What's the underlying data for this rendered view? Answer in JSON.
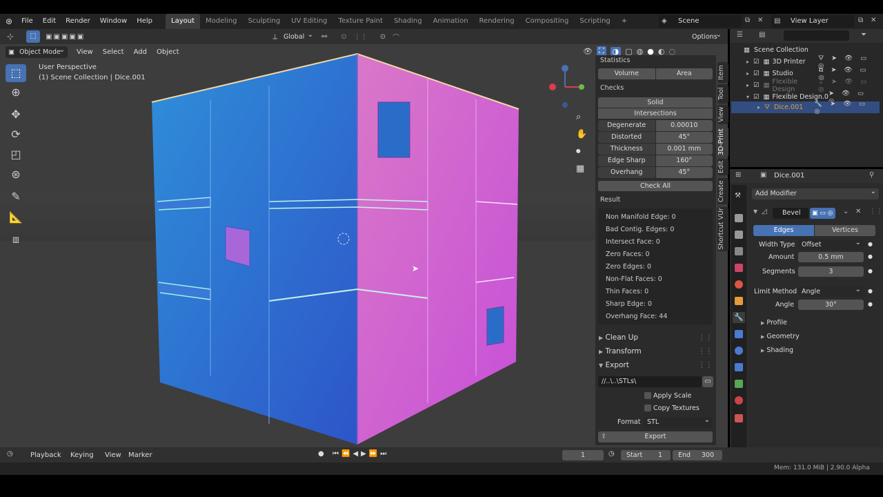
{
  "menu": [
    "File",
    "Edit",
    "Render",
    "Window",
    "Help"
  ],
  "workspaces": [
    "Layout",
    "Modeling",
    "Sculpting",
    "UV Editing",
    "Texture Paint",
    "Shading",
    "Animation",
    "Rendering",
    "Compositing",
    "Scripting"
  ],
  "active_workspace": "Layout",
  "scene": "Scene",
  "view_layer": "View Layer",
  "toolbar": {
    "orientation": "Global",
    "options": "Options"
  },
  "viewport_header": {
    "mode": "Object Mode",
    "menus": [
      "View",
      "Select",
      "Add",
      "Object"
    ]
  },
  "viewport_info": {
    "line1": "User Perspective",
    "line2": "(1) Scene Collection | Dice.001"
  },
  "print3d": {
    "statistics_label": "Statistics",
    "volume": "Volume",
    "area": "Area",
    "checks_label": "Checks",
    "solid": "Solid",
    "intersections": "Intersections",
    "params": [
      {
        "label": "Degenerate",
        "value": "0.00010"
      },
      {
        "label": "Distorted",
        "value": "45°"
      },
      {
        "label": "Thickness",
        "value": "0.001 mm"
      },
      {
        "label": "Edge Sharp",
        "value": "160°"
      },
      {
        "label": "Overhang",
        "value": "45°"
      }
    ],
    "check_all": "Check All",
    "result_label": "Result",
    "results": [
      "Non Manifold Edge: 0",
      "Bad Contig. Edges: 0",
      "Intersect Face: 0",
      "Zero Faces: 0",
      "Zero Edges: 0",
      "Non-Flat Faces: 0",
      "Thin Faces: 0",
      "Sharp Edge: 0",
      "Overhang Face: 44"
    ],
    "sections": {
      "cleanup": "Clean Up",
      "transform": "Transform",
      "export": "Export"
    },
    "export_path": "//..\\..\\STLs\\",
    "apply_scale": "Apply Scale",
    "copy_textures": "Copy Textures",
    "format_label": "Format",
    "format_value": "STL",
    "export_button": "Export"
  },
  "sidebar_tabs": [
    "Item",
    "Tool",
    "View",
    "3D-Print",
    "Edit",
    "Create",
    "Shortcut VUr"
  ],
  "outliner": {
    "root": "Scene Collection",
    "items": [
      "3D Printer",
      "Studio",
      "Flexible Design",
      "Flexible Design.00",
      "Dice.001"
    ]
  },
  "properties": {
    "object": "Dice.001",
    "add_modifier": "Add Modifier",
    "modifier_name": "Bevel",
    "edges": "Edges",
    "vertices": "Vertices",
    "rows": [
      {
        "label": "Width Type",
        "value": "Offset"
      },
      {
        "label": "Amount",
        "value": "0.5 mm"
      },
      {
        "label": "Segments",
        "value": "3"
      },
      {
        "label": "Limit Method",
        "value": "Angle"
      },
      {
        "label": "Angle",
        "value": "30°"
      }
    ],
    "subpanels": [
      "Profile",
      "Geometry",
      "Shading"
    ]
  },
  "timeline": {
    "menus": [
      "Playback",
      "Keying",
      "View",
      "Marker"
    ],
    "frame": "1",
    "start_label": "Start",
    "start": "1",
    "end_label": "End",
    "end": "300"
  },
  "status": "Mem: 131.0 MiB | 2.90.0 Alpha",
  "colors": {
    "accent": "#4772b3",
    "orange": "#e59c39"
  }
}
